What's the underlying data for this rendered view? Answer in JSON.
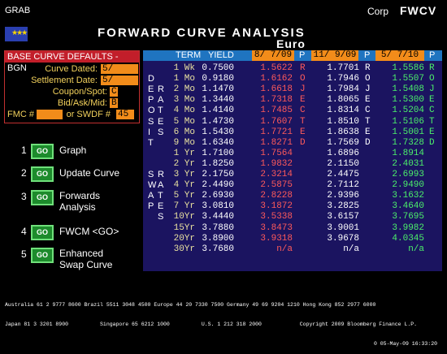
{
  "header": {
    "grab": "GRAB",
    "corp": "Corp",
    "ticker": "FWCV"
  },
  "title": "FORWARD CURVE ANALYSIS",
  "subtitle": "Euro",
  "defaults": {
    "heading": "BASE CURVE DEFAULTS - BGN",
    "curve_dated_label": "Curve Dated:",
    "curve_dated_value": "5/ 5/09",
    "settlement_label": "Settlement Date:",
    "settlement_value": "5/ 7/09",
    "coupon_label": "Coupon/Spot:",
    "coupon_value": "C",
    "bidask_label": "Bid/Ask/Mid:",
    "bidask_value": "B",
    "fmc_label": "FMC #",
    "fmc_value": "",
    "swdf_label": "or SWDF #",
    "swdf_value": "45"
  },
  "menu": [
    {
      "num": "1",
      "go": "GO",
      "label": "Graph"
    },
    {
      "num": "2",
      "go": "GO",
      "label": "Update Curve"
    },
    {
      "num": "3",
      "go": "GO",
      "label": "Forwards",
      "label2": "Analysis"
    },
    {
      "num": "4",
      "go": "GO",
      "label": "FWCM <GO>"
    },
    {
      "num": "5",
      "go": "GO",
      "label": "Enhanced",
      "label2": "Swap Curve"
    }
  ],
  "table": {
    "col_term": "TERM",
    "col_yield": "YIELD",
    "date1": "8/ 7/09",
    "p1": "P",
    "date2": "11/ 9/09",
    "p2": "P",
    "date3": "5/ 7/10",
    "p3": "P",
    "deposit_letters": [
      "D",
      "E",
      "P",
      "O",
      "S",
      "I",
      "T"
    ],
    "deposit_letters2": [
      "",
      "R",
      "A",
      "T",
      "E",
      "S",
      ""
    ],
    "swap_letters": [
      "S",
      "W",
      "A",
      "P",
      "",
      ""
    ],
    "swap_letters2": [
      "R",
      "A",
      "T",
      "E",
      "S",
      ""
    ],
    "rows": [
      {
        "term": "1 Wk",
        "yield": "0.7500",
        "f1": "1.5622",
        "c1": "R",
        "f2": "1.7701",
        "c2": "R",
        "f3": "1.5586",
        "c3": "R"
      },
      {
        "term": "1 Mo",
        "yield": "0.9180",
        "f1": "1.6162",
        "c1": "O",
        "f2": "1.7946",
        "c2": "O",
        "f3": "1.5507",
        "c3": "O"
      },
      {
        "term": "2 Mo",
        "yield": "1.1470",
        "f1": "1.6618",
        "c1": "J",
        "f2": "1.7984",
        "c2": "J",
        "f3": "1.5408",
        "c3": "J"
      },
      {
        "term": "3 Mo",
        "yield": "1.3440",
        "f1": "1.7318",
        "c1": "E",
        "f2": "1.8065",
        "c2": "E",
        "f3": "1.5300",
        "c3": "E"
      },
      {
        "term": "4 Mo",
        "yield": "1.4140",
        "f1": "1.7485",
        "c1": "C",
        "f2": "1.8314",
        "c2": "C",
        "f3": "1.5204",
        "c3": "C"
      },
      {
        "term": "5 Mo",
        "yield": "1.4730",
        "f1": "1.7607",
        "c1": "T",
        "f2": "1.8510",
        "c2": "T",
        "f3": "1.5106",
        "c3": "T"
      },
      {
        "term": "6 Mo",
        "yield": "1.5430",
        "f1": "1.7721",
        "c1": "E",
        "f2": "1.8638",
        "c2": "E",
        "f3": "1.5001",
        "c3": "E"
      },
      {
        "term": "9 Mo",
        "yield": "1.6340",
        "f1": "1.8271",
        "c1": "D",
        "f2": "1.7569",
        "c2": "D",
        "f3": "1.7328",
        "c3": "D"
      },
      {
        "term": "1 Yr",
        "yield": "1.7100",
        "f1": "1.7564",
        "c1": "",
        "f2": "1.6896",
        "c2": "",
        "f3": "1.8914",
        "c3": ""
      },
      {
        "term": "2 Yr",
        "yield": "1.8250",
        "f1": "1.9832",
        "c1": "",
        "f2": "2.1150",
        "c2": "",
        "f3": "2.4031",
        "c3": ""
      },
      {
        "term": "3 Yr",
        "yield": "2.1750",
        "f1": "2.3214",
        "c1": "",
        "f2": "2.4475",
        "c2": "",
        "f3": "2.6993",
        "c3": ""
      },
      {
        "term": "4 Yr",
        "yield": "2.4490",
        "f1": "2.5875",
        "c1": "",
        "f2": "2.7112",
        "c2": "",
        "f3": "2.9490",
        "c3": ""
      },
      {
        "term": "5 Yr",
        "yield": "2.6930",
        "f1": "2.8228",
        "c1": "",
        "f2": "2.9396",
        "c2": "",
        "f3": "3.1632",
        "c3": ""
      },
      {
        "term": "7 Yr",
        "yield": "3.0810",
        "f1": "3.1872",
        "c1": "",
        "f2": "3.2825",
        "c2": "",
        "f3": "3.4640",
        "c3": ""
      },
      {
        "term": "10Yr",
        "yield": "3.4440",
        "f1": "3.5338",
        "c1": "",
        "f2": "3.6157",
        "c2": "",
        "f3": "3.7695",
        "c3": ""
      },
      {
        "term": "15Yr",
        "yield": "3.7880",
        "f1": "3.8473",
        "c1": "",
        "f2": "3.9001",
        "c2": "",
        "f3": "3.9982",
        "c3": ""
      },
      {
        "term": "20Yr",
        "yield": "3.8900",
        "f1": "3.9318",
        "c1": "",
        "f2": "3.9678",
        "c2": "",
        "f3": "4.0345",
        "c3": ""
      },
      {
        "term": "30Yr",
        "yield": "3.7680",
        "f1": "n/a",
        "c1": "",
        "f2": "n/a",
        "c2": "",
        "f3": "n/a",
        "c3": ""
      }
    ]
  },
  "footer": {
    "line1": "Australia 61 2 9777 8600 Brazil 5511 3048 4500 Europe 44 20 7330 7500 Germany 49 69 9204 1210 Hong Kong 852 2977 6000",
    "line2": "Japan 81 3 3201 8900          Singapore 65 6212 1000          U.S. 1 212 318 2000            Copyright 2009 Bloomberg Finance L.P.",
    "line3": "0 05-May-09 16:33:20"
  },
  "colors": {
    "accent": "#f28c1a",
    "header_blue": "#1f74c0",
    "panel": "#1b1460",
    "red": "#ff5a5a",
    "green": "#4cf06a"
  }
}
